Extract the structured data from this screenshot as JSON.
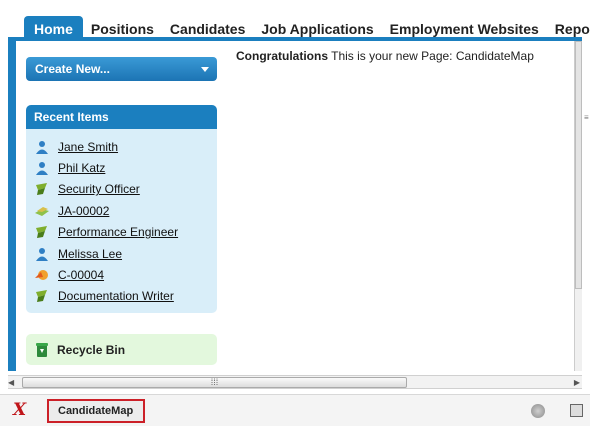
{
  "tabs": [
    {
      "label": "Home",
      "active": true
    },
    {
      "label": "Positions"
    },
    {
      "label": "Candidates"
    },
    {
      "label": "Job Applications"
    },
    {
      "label": "Employment Websites"
    },
    {
      "label": "Reports"
    }
  ],
  "sidebar": {
    "create_new_label": "Create New...",
    "recent_items_title": "Recent Items",
    "recent_items": [
      {
        "label": "Jane Smith",
        "icon": "person-icon"
      },
      {
        "label": "Phil Katz",
        "icon": "person-icon"
      },
      {
        "label": "Security Officer",
        "icon": "position-icon"
      },
      {
        "label": "JA-00002",
        "icon": "job-application-icon"
      },
      {
        "label": "Performance Engineer",
        "icon": "position-icon"
      },
      {
        "label": "Melissa Lee",
        "icon": "person-icon"
      },
      {
        "label": "C-00004",
        "icon": "candidate-icon"
      },
      {
        "label": "Documentation Writer",
        "icon": "position-icon"
      }
    ],
    "recycle_bin_label": "Recycle Bin"
  },
  "main": {
    "message_bold": "Congratulations",
    "message_text": " This is your new Page: CandidateMap"
  },
  "bottombar": {
    "page_tab_label": "CandidateMap"
  }
}
